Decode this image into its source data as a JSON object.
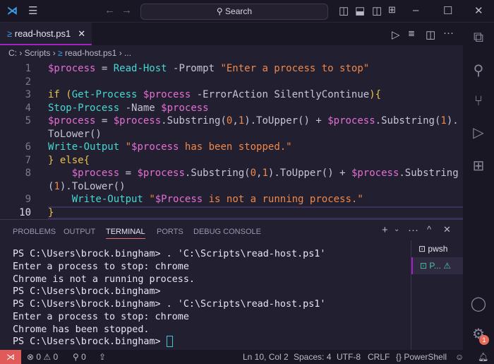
{
  "titlebar": {
    "search_label": "Search"
  },
  "tab": {
    "label": "read-host.ps1"
  },
  "breadcrumb": {
    "items": [
      "C:",
      "Scripts",
      "read-host.ps1",
      "..."
    ]
  },
  "editor": {
    "current_line": 10,
    "lines": [
      [
        [
          "var",
          "$process"
        ],
        [
          "plain",
          " = "
        ],
        [
          "cmd",
          "Read-Host"
        ],
        [
          "param",
          " -Prompt "
        ],
        [
          "str",
          "\"Enter a process to stop\""
        ]
      ],
      [],
      [
        [
          "kw",
          "if "
        ],
        [
          "brace",
          "("
        ],
        [
          "cmd",
          "Get-Process"
        ],
        [
          "plain",
          " "
        ],
        [
          "var",
          "$process"
        ],
        [
          "param",
          " -ErrorAction SilentlyContinue"
        ],
        [
          "brace",
          "){"
        ]
      ],
      [
        [
          "cmd",
          "Stop-Process"
        ],
        [
          "param",
          " -Name "
        ],
        [
          "var",
          "$process"
        ]
      ],
      [
        [
          "var",
          "$process"
        ],
        [
          "plain",
          " = "
        ],
        [
          "var",
          "$process"
        ],
        [
          "plain",
          ".Substring("
        ],
        [
          "num",
          "0"
        ],
        [
          "plain",
          ","
        ],
        [
          "num",
          "1"
        ],
        [
          "plain",
          ").ToUpper() + "
        ],
        [
          "var",
          "$process"
        ],
        [
          "plain",
          ".Substring("
        ],
        [
          "num",
          "1"
        ],
        [
          "plain",
          ").ToLower()"
        ]
      ],
      [
        [
          "cmd",
          "Write-Output"
        ],
        [
          "plain",
          " "
        ],
        [
          "str",
          "\""
        ],
        [
          "var",
          "$process"
        ],
        [
          "str",
          " has been stopped.\""
        ]
      ],
      [
        [
          "brace",
          "}"
        ],
        [
          "kw",
          " else"
        ],
        [
          "brace",
          "{"
        ]
      ],
      [
        [
          "plain",
          "    "
        ],
        [
          "var",
          "$process"
        ],
        [
          "plain",
          " = "
        ],
        [
          "var",
          "$process"
        ],
        [
          "plain",
          ".Substring("
        ],
        [
          "num",
          "0"
        ],
        [
          "plain",
          ","
        ],
        [
          "num",
          "1"
        ],
        [
          "plain",
          ").ToUpper() + "
        ],
        [
          "var",
          "$process"
        ],
        [
          "plain",
          ".Substring("
        ],
        [
          "num",
          "1"
        ],
        [
          "plain",
          ").ToLower()"
        ]
      ],
      [
        [
          "plain",
          "    "
        ],
        [
          "cmd",
          "Write-Output"
        ],
        [
          "plain",
          " "
        ],
        [
          "str",
          "\""
        ],
        [
          "var",
          "$Process"
        ],
        [
          "str",
          " is not a running process.\""
        ]
      ],
      [
        [
          "brace",
          "}"
        ]
      ]
    ]
  },
  "panel": {
    "tabs": [
      "PROBLEMS",
      "OUTPUT",
      "TERMINAL",
      "PORTS",
      "DEBUG CONSOLE"
    ],
    "active_tab": "TERMINAL",
    "terminal_lines": [
      "PS C:\\Users\\brock.bingham> . 'C:\\Scripts\\read-host.ps1'",
      "Enter a process to stop: chrome",
      "Chrome is not a running process.",
      "PS C:\\Users\\brock.bingham>",
      "PS C:\\Users\\brock.bingham> . 'C:\\Scripts\\read-host.ps1'",
      "Enter a process to stop: chrome",
      "Chrome has been stopped.",
      "PS C:\\Users\\brock.bingham> "
    ],
    "terminals": [
      {
        "label": "pwsh"
      },
      {
        "label": "P...",
        "warning": true
      }
    ]
  },
  "activity": {
    "settings_badge": "1"
  },
  "status": {
    "errors": "0",
    "warnings": "0",
    "ports": "0",
    "position": "Ln 10, Col 2",
    "spaces": "Spaces: 4",
    "encoding": "UTF-8",
    "eol": "CRLF",
    "language": "PowerShell"
  }
}
